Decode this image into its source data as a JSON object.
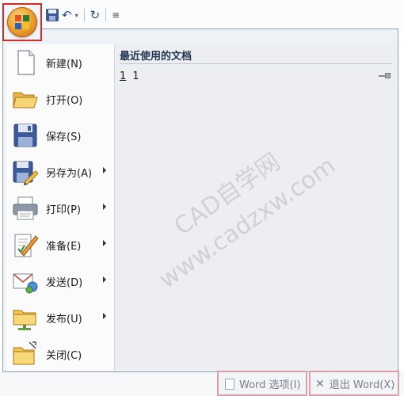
{
  "quick_access": {
    "save_icon": "save-icon",
    "undo_glyph": "↶",
    "dropdown_glyph": "▾",
    "redo_glyph": "↻",
    "customize_glyph": "≡"
  },
  "menu": {
    "items": [
      {
        "label": "新建(N)",
        "icon": "new-document-icon",
        "has_submenu": false
      },
      {
        "label": "打开(O)",
        "icon": "open-folder-icon",
        "has_submenu": false
      },
      {
        "label": "保存(S)",
        "icon": "save-floppy-icon",
        "has_submenu": false
      },
      {
        "label": "另存为(A)",
        "icon": "save-as-icon",
        "has_submenu": true
      },
      {
        "label": "打印(P)",
        "icon": "printer-icon",
        "has_submenu": true
      },
      {
        "label": "准备(E)",
        "icon": "prepare-document-icon",
        "has_submenu": true
      },
      {
        "label": "发送(D)",
        "icon": "send-mail-icon",
        "has_submenu": true
      },
      {
        "label": "发布(U)",
        "icon": "publish-folder-icon",
        "has_submenu": true
      },
      {
        "label": "关闭(C)",
        "icon": "close-folder-icon",
        "has_submenu": false
      }
    ]
  },
  "recent": {
    "title": "最近使用的文档",
    "items": [
      {
        "number": "1",
        "name": "1"
      }
    ]
  },
  "footer": {
    "options_label": "Word 选项(I)",
    "exit_label": "退出 Word(X)"
  },
  "watermark": {
    "line1": "CAD自学网",
    "line2": "www.cadzxw.com"
  },
  "colors": {
    "highlight_border": "#d32a2a",
    "menu_border": "#8f9fb7",
    "right_pane": "#eceef2"
  }
}
